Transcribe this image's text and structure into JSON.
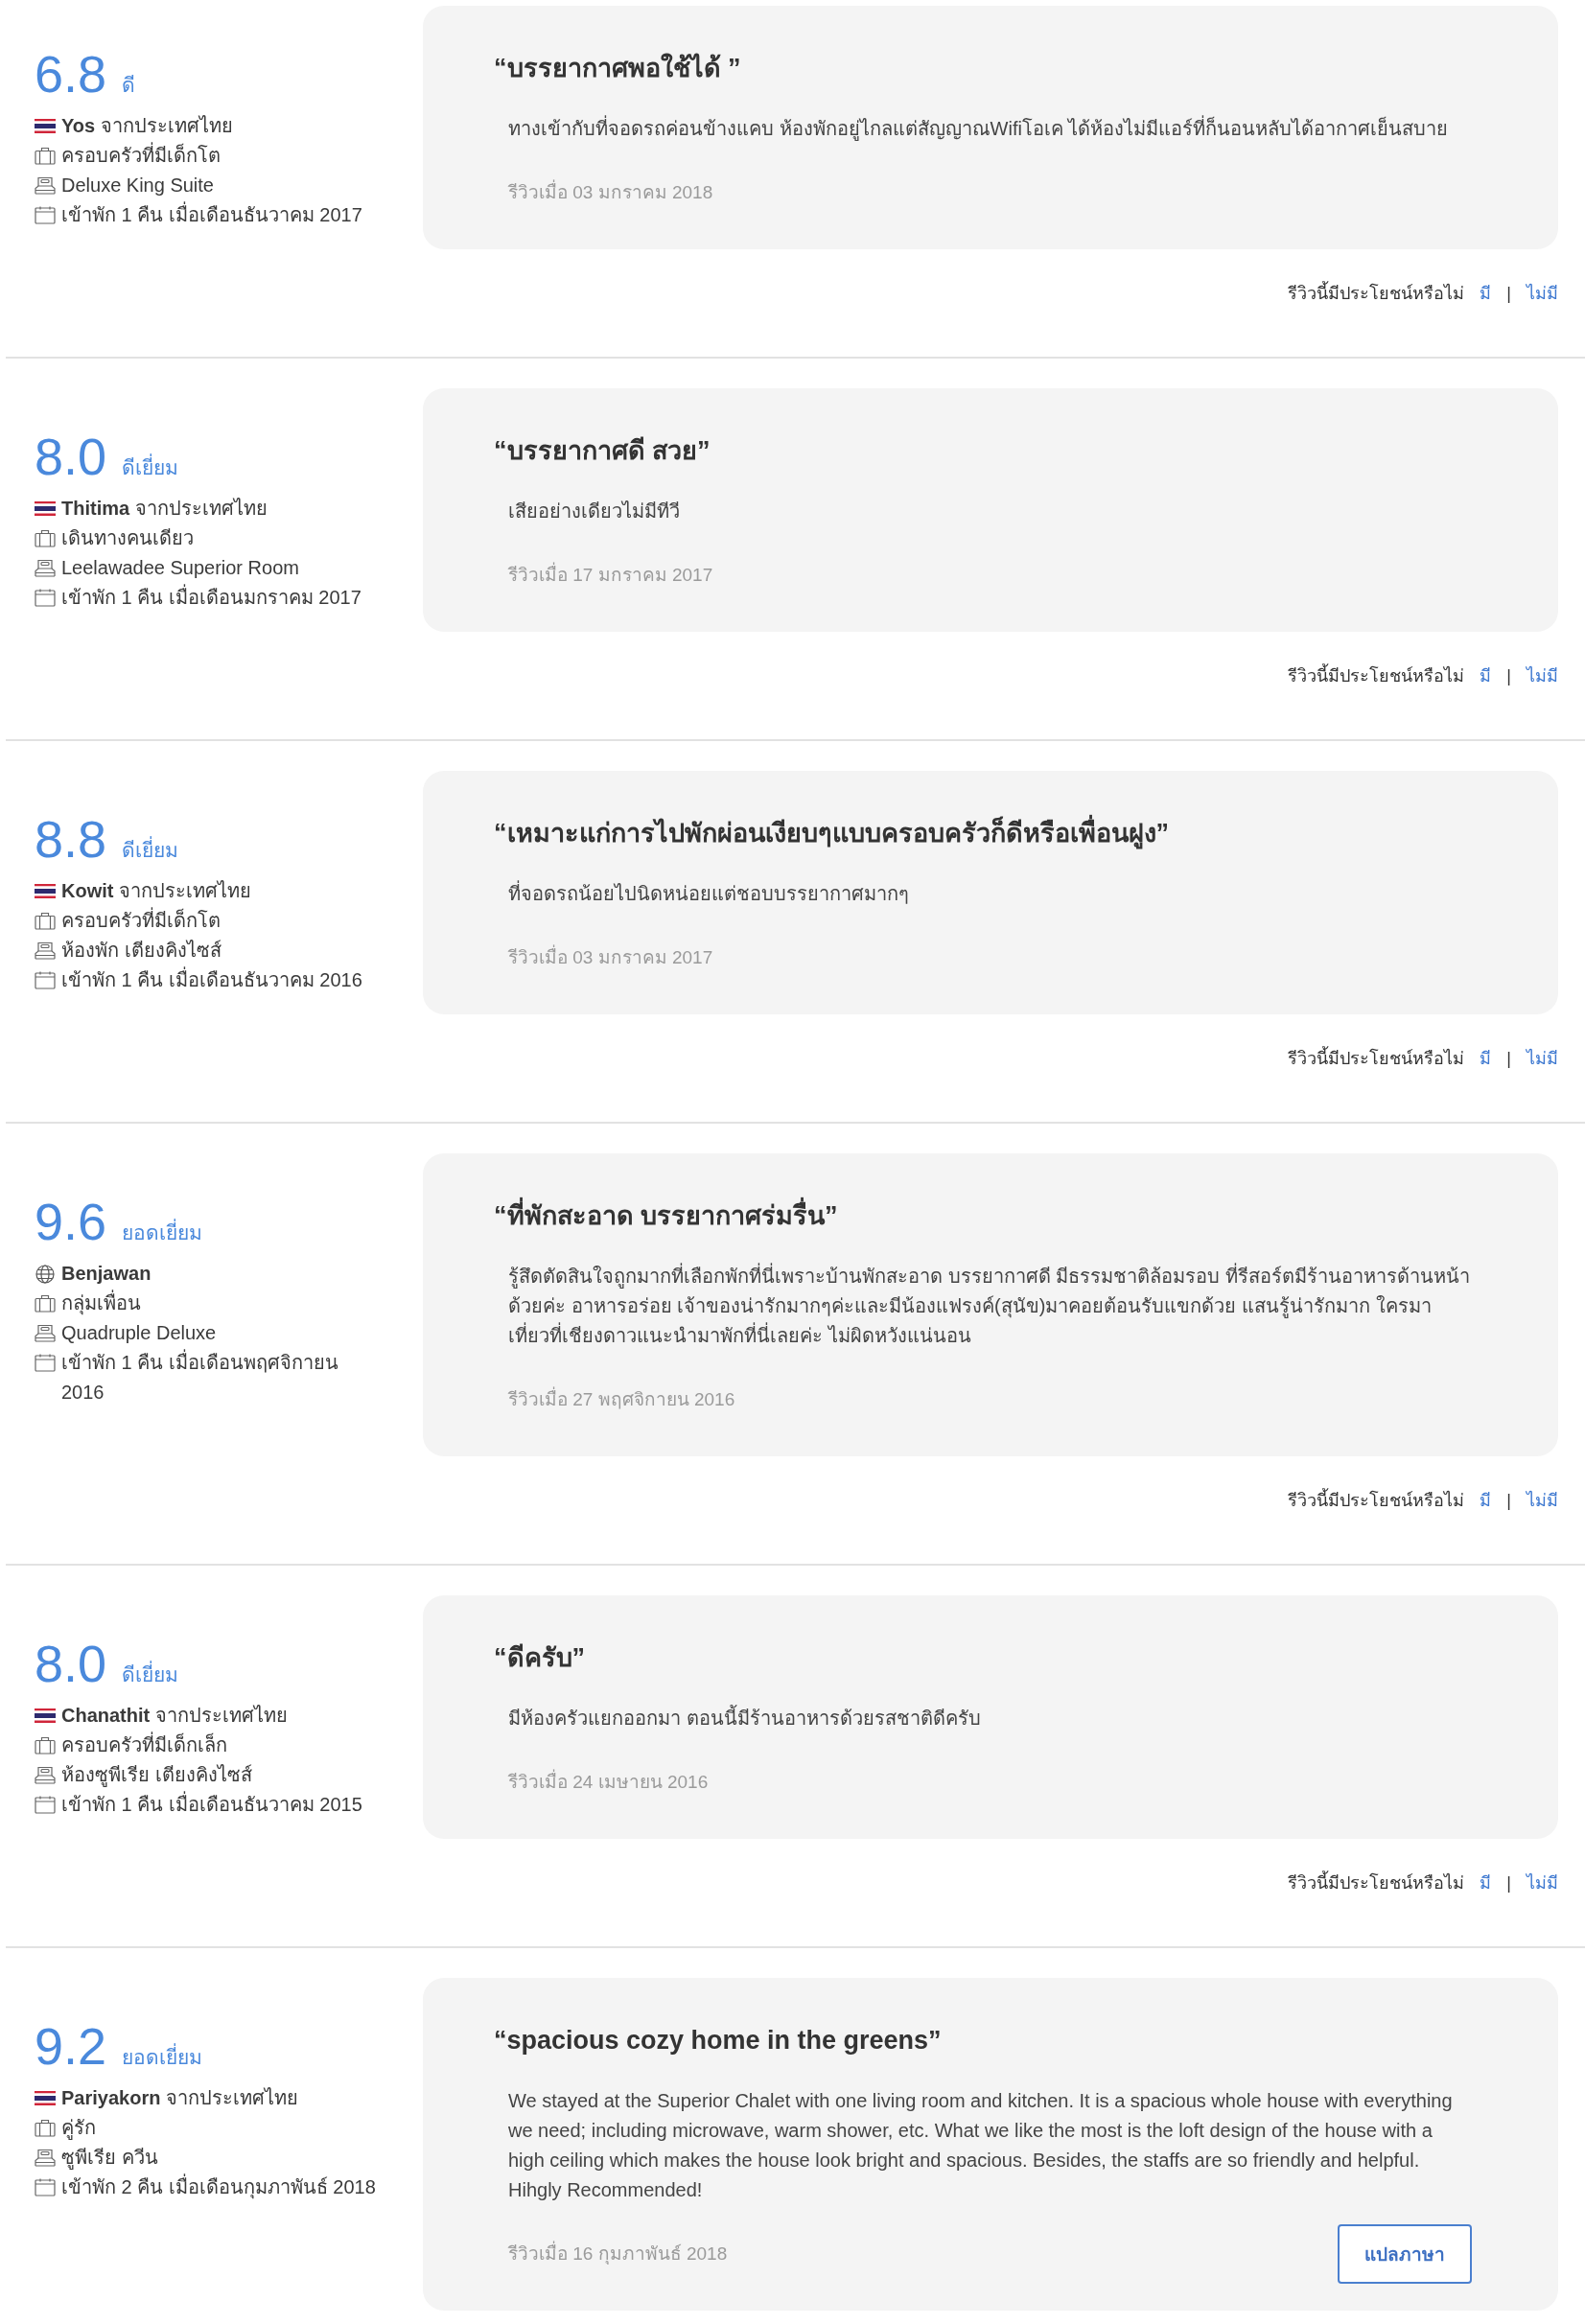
{
  "reviews": [
    {
      "score": "6.8",
      "score_label": "ดี",
      "reviewer": {
        "name": "Yos",
        "origin": "จากประเทศไทย"
      },
      "traveler_type": "ครอบครัวที่มีเด็กโต",
      "room": "Deluxe King Suite",
      "stay": "เข้าพัก 1 คืน เมื่อเดือนธันวาคม 2017",
      "title": "“บรรยากาศพอใช้ได้ ”",
      "body": "ทางเข้ากับที่จอดรถค่อนข้างแคบ ห้องพักอยู่ไกลแต่สัญญาณWifiโอเค ได้ห้องไม่มีแอร์ที่ก็นอนหลับได้อากาศเย็นสบาย",
      "date": "รีวิวเมื่อ 03 มกราคม 2018",
      "helpful": {
        "question": "รีวิวนี้มีประโยชน์หรือไม่",
        "yes": "มี",
        "separator": "|",
        "no": "ไม่มี"
      }
    },
    {
      "score": "8.0",
      "score_label": "ดีเยี่ยม",
      "reviewer": {
        "name": "Thitima",
        "origin": "จากประเทศไทย"
      },
      "traveler_type": "เดินทางคนเดียว",
      "room": "Leelawadee Superior Room",
      "stay": "เข้าพัก 1 คืน เมื่อเดือนมกราคม 2017",
      "title": "“บรรยากาศดี สวย”",
      "body": "เสียอย่างเดียวไม่มีทีวี",
      "date": "รีวิวเมื่อ 17 มกราคม 2017",
      "helpful": {
        "question": "รีวิวนี้มีประโยชน์หรือไม่",
        "yes": "มี",
        "separator": "|",
        "no": "ไม่มี"
      }
    },
    {
      "score": "8.8",
      "score_label": "ดีเยี่ยม",
      "reviewer": {
        "name": "Kowit",
        "origin": "จากประเทศไทย"
      },
      "traveler_type": "ครอบครัวที่มีเด็กโต",
      "room": "ห้องพัก เตียงคิงไซส์",
      "stay": "เข้าพัก 1 คืน เมื่อเดือนธันวาคม 2016",
      "title": "“เหมาะแก่การไปพักผ่อนเงียบๆแบบครอบครัวก็ดีหรือเพื่อนฝูง”",
      "body": "ที่จอดรถน้อยไปนิดหน่อยแต่ชอบบรรยากาศมากๆ",
      "date": "รีวิวเมื่อ 03 มกราคม 2017",
      "helpful": {
        "question": "รีวิวนี้มีประโยชน์หรือไม่",
        "yes": "มี",
        "separator": "|",
        "no": "ไม่มี"
      }
    },
    {
      "score": "9.6",
      "score_label": "ยอดเยี่ยม",
      "reviewer": {
        "name": "Benjawan"
      },
      "traveler_type": "กลุ่มเพื่อน",
      "room": "Quadruple Deluxe",
      "stay": "เข้าพัก 1 คืน เมื่อเดือนพฤศจิกายน 2016",
      "title": "“ที่พักสะอาด บรรยากาศร่มรื่น”",
      "body": "รู้สึดตัดสินใจถูกมากที่เลือกพักที่นี่เพราะบ้านพักสะอาด บรรยากาศดี มีธรรมชาติล้อมรอบ ที่รีสอร์ตมีร้านอาหารด้านหน้าด้วยค่ะ อาหารอร่อย เจ้าของน่ารักมากๆค่ะและมีน้องแฟรงค์(สุนัข)มาคอยต้อนรับแขกด้วย แสนรู้น่ารักมาก ใครมาเที่ยวที่เชียงดาวแนะนำมาพักที่นี่เลยค่ะ ไม่ผิดหวังแน่นอน",
      "date": "รีวิวเมื่อ 27 พฤศจิกายน 2016",
      "helpful": {
        "question": "รีวิวนี้มีประโยชน์หรือไม่",
        "yes": "มี",
        "separator": "|",
        "no": "ไม่มี"
      }
    },
    {
      "score": "8.0",
      "score_label": "ดีเยี่ยม",
      "reviewer": {
        "name": "Chanathit",
        "origin": "จากประเทศไทย"
      },
      "traveler_type": "ครอบครัวที่มีเด็กเล็ก",
      "room": "ห้องซูพีเรีย เตียงคิงไซส์",
      "stay": "เข้าพัก 1 คืน เมื่อเดือนธันวาคม 2015",
      "title": "“ดีครับ”",
      "body": "มีห้องครัวแยกออกมา ตอนนี้มีร้านอาหารด้วยรสชาติดีครับ",
      "date": "รีวิวเมื่อ 24 เมษายน 2016",
      "helpful": {
        "question": "รีวิวนี้มีประโยชน์หรือไม่",
        "yes": "มี",
        "separator": "|",
        "no": "ไม่มี"
      }
    },
    {
      "score": "9.2",
      "score_label": "ยอดเยี่ยม",
      "reviewer": {
        "name": "Pariyakorn",
        "origin": "จากประเทศไทย"
      },
      "traveler_type": "คู่รัก",
      "room": "ซูพีเรีย ควีน",
      "stay": "เข้าพัก 2 คืน เมื่อเดือนกุมภาพันธ์ 2018",
      "title": "“spacious cozy home in the greens”",
      "body": "We stayed at the Superior Chalet with one living room and kitchen. It is a spacious whole house with everything we need; including microwave, warm shower, etc. What we like the most is the loft design of the house with a high ceiling which makes the house look bright and spacious. Besides, the staffs are so friendly and helpful. Hihgly Recommended!",
      "date": "รีวิวเมื่อ 16 กุมภาพันธ์ 2018",
      "translate_button": "แปลภาษา"
    }
  ]
}
